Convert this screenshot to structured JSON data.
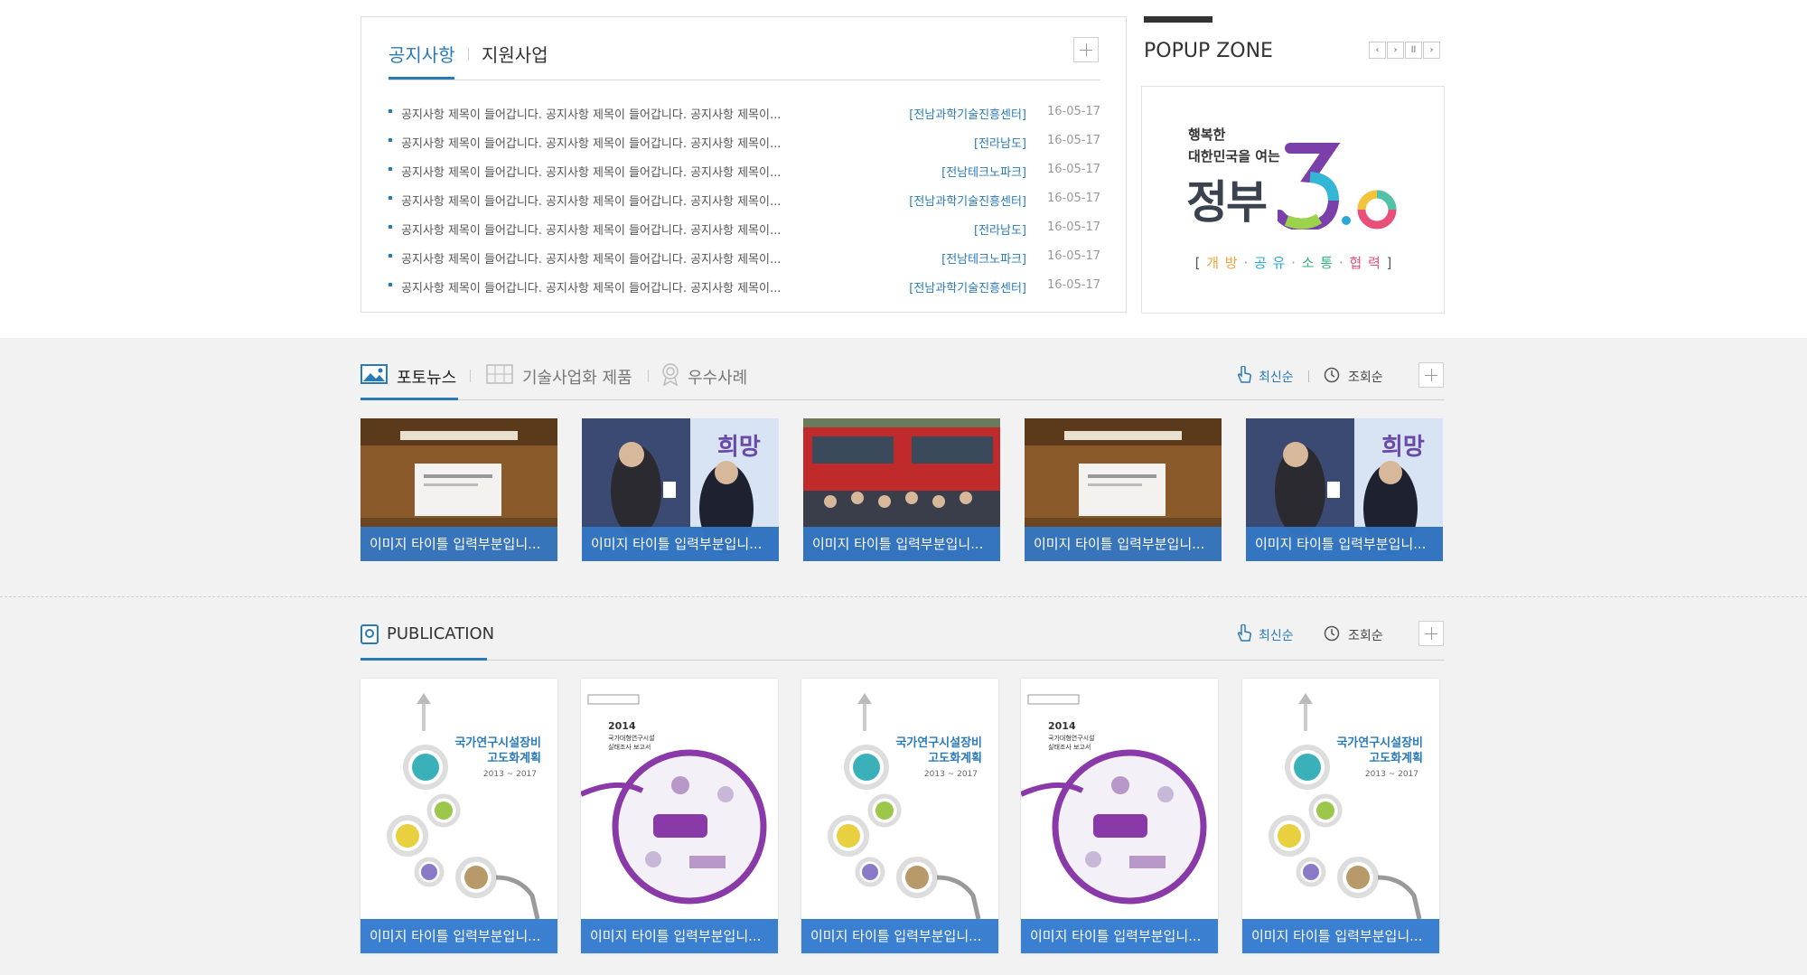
{
  "notice": {
    "tabs": [
      {
        "label": "공지사항"
      },
      {
        "label": "지원사업"
      }
    ],
    "rows": [
      {
        "title": "공지사항 제목이 들어갑니다. 공지사항 제목이 들어갑니다. 공지사항 제목이...",
        "org": "[전남과학기술진흥센터]",
        "date": "16-05-17"
      },
      {
        "title": "공지사항 제목이 들어갑니다.  공지사항 제목이 들어갑니다. 공지사항 제목이...",
        "org": "[전라남도]",
        "date": "16-05-17"
      },
      {
        "title": "공지사항 제목이 들어갑니다. 공지사항 제목이 들어갑니다. 공지사항 제목이...",
        "org": "[전남테크노파크]",
        "date": "16-05-17"
      },
      {
        "title": "공지사항 제목이 들어갑니다. 공지사항 제목이 들어갑니다. 공지사항 제목이...",
        "org": "[전남과학기술진흥센터]",
        "date": "16-05-17"
      },
      {
        "title": "공지사항 제목이 들어갑니다. 공지사항 제목이 들어갑니다. 공지사항 제목이...",
        "org": "[전라남도]",
        "date": "16-05-17"
      },
      {
        "title": "공지사항 제목이 들어갑니다. 공지사항 제목이 들어갑니다. 공지사항 제목이...",
        "org": "[전남테크노파크]",
        "date": "16-05-17"
      },
      {
        "title": "공지사항 제목이 들어갑니다. 공지사항 제목이 들어갑니다. 공지사항 제목이...",
        "org": "[전남과학기술진흥센터]",
        "date": "16-05-17"
      }
    ]
  },
  "popup": {
    "title": "POPUP ZONE",
    "controls": [
      "‹",
      "›",
      "ll",
      "›"
    ],
    "banner": {
      "line1": "행복한",
      "line2": "대한민국을 여는",
      "main": "정부",
      "version": "3.0",
      "bracket_open": "[",
      "bracket_close": "]",
      "keywords": [
        {
          "text": "개 방",
          "color": "#f2a23a"
        },
        {
          "text": "공 유",
          "color": "#2aa8d8"
        },
        {
          "text": "소 통",
          "color": "#35b27a"
        },
        {
          "text": "협 력",
          "color": "#e8507a"
        }
      ],
      "sep": "·"
    }
  },
  "media": {
    "tabs": [
      {
        "label": "포토뉴스"
      },
      {
        "label": "기술사업화 제품"
      },
      {
        "label": "우수사례"
      }
    ],
    "sort": {
      "latest": "최신순",
      "views": "조회순"
    },
    "items": [
      {
        "caption": "이미지 타이틀 입력부분입니..."
      },
      {
        "caption": "이미지 타이틀 입력부분입니..."
      },
      {
        "caption": "이미지 타이틀 입력부분입니..."
      },
      {
        "caption": "이미지 타이틀 입력부분입니..."
      },
      {
        "caption": "이미지 타이틀 입력부분입니..."
      }
    ]
  },
  "publication": {
    "title": "PUBLICATION",
    "sort": {
      "latest": "최신순",
      "views": "조회순"
    },
    "covers": {
      "a": {
        "title1": "국가연구시설장비",
        "title2": "고도화계획",
        "years": "2013 ~ 2017"
      },
      "b": {
        "year": "2014",
        "sub1": "국가대형연구시설",
        "sub2": "실태조사 보고서"
      }
    },
    "items": [
      {
        "caption": "이미지 타이틀 입력부분입니..."
      },
      {
        "caption": "이미지 타이틀 입력부분입니..."
      },
      {
        "caption": "이미지 타이틀 입력부분입니..."
      },
      {
        "caption": "이미지 타이틀 입력부분입니..."
      },
      {
        "caption": "이미지 타이틀 입력부분입니..."
      }
    ]
  }
}
